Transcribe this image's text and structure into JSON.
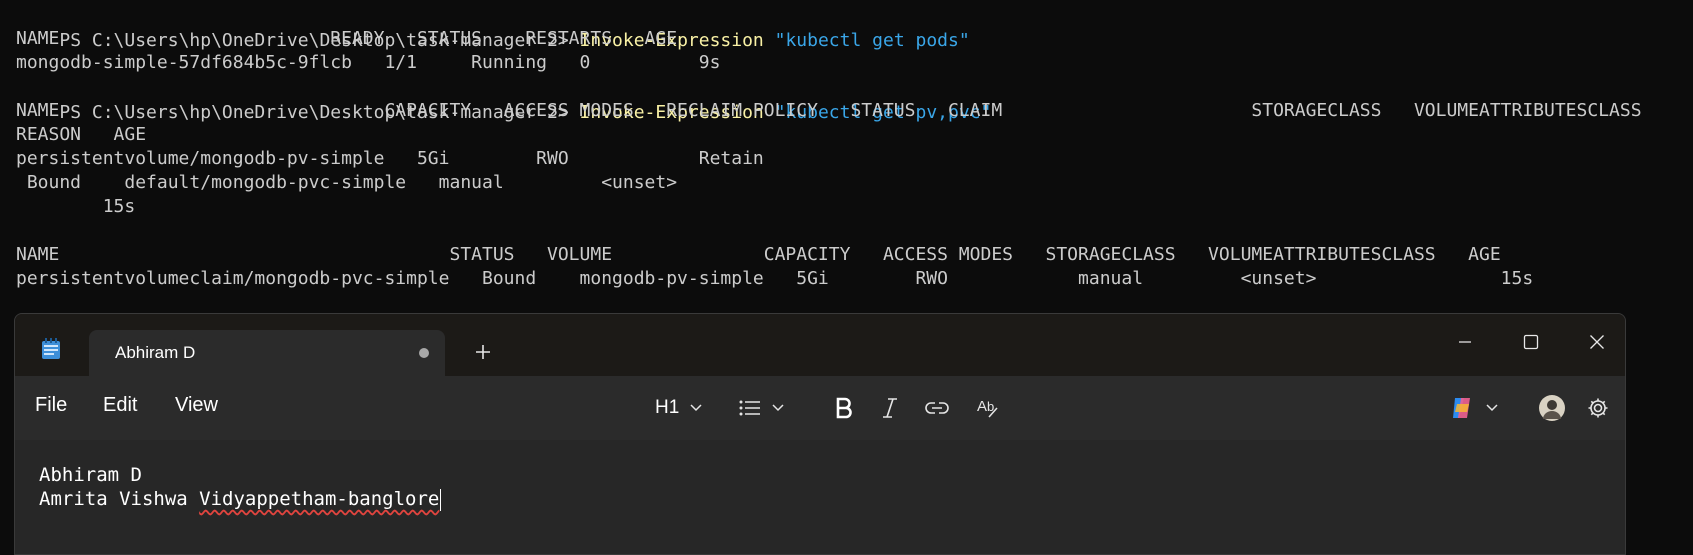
{
  "terminal": {
    "prompt": "PS C:\\Users\\hp\\OneDrive\\Desktop\\task-manager 2> ",
    "cmd1_keyword": "Invoke-Expression",
    "cmd1_arg": "\"kubectl get pods\"",
    "pods_header": "NAME                         READY   STATUS    RESTARTS   AGE",
    "pods_row": "mongodb-simple-57df684b5c-9flcb   1/1     Running   0          9s",
    "cmd2_keyword": "Invoke-Expression",
    "cmd2_arg": "\"kubectl get pv,pvc\"",
    "pv_header": "NAME                              CAPACITY   ACCESS MODES   RECLAIM POLICY   STATUS   CLAIM                       STORAGECLASS   VOLUMEATTRIBUTESCLASS",
    "pv_header_wrap": "REASON   AGE",
    "pv_row": "persistentvolume/mongodb-pv-simple   5Gi        RWO            Retain",
    "pv_row_wrap1": " Bound    default/mongodb-pvc-simple   manual         <unset>",
    "pv_row_wrap2": "        15s",
    "pvc_header": "NAME                                    STATUS   VOLUME              CAPACITY   ACCESS MODES   STORAGECLASS   VOLUMEATTRIBUTESCLASS   AGE",
    "pvc_row": "persistentvolumeclaim/mongodb-pvc-simple   Bound    mongodb-pv-simple   5Gi        RWO            manual         <unset>                 15s"
  },
  "notepad": {
    "tab_title": "Abhiram D",
    "menu": {
      "file": "File",
      "edit": "Edit",
      "view": "View"
    },
    "toolbar": {
      "heading": "H1"
    },
    "content": {
      "line1": "Abhiram D",
      "line2_prefix": "Amrita Vishwa ",
      "line2_misspelled": "Vidyappetham-banglore"
    }
  },
  "colors": {
    "terminal_bg": "#0c0c0c",
    "command_keyword": "#f9f1a5",
    "command_string": "#3aa6e8",
    "notepad_bg": "#272727",
    "spell_underline": "#e0443e"
  }
}
